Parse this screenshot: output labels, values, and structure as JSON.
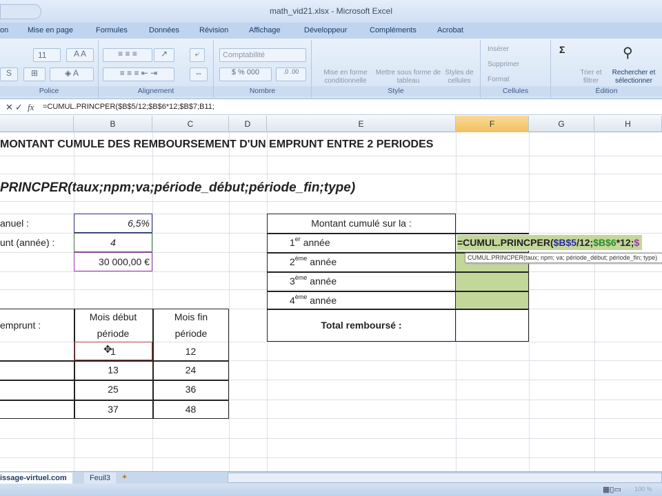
{
  "window": {
    "title": "math_vid21.xlsx - Microsoft Excel"
  },
  "ribbon_tabs": [
    "on",
    "Mise en page",
    "Formules",
    "Données",
    "Révision",
    "Affichage",
    "Développeur",
    "Compléments",
    "Acrobat"
  ],
  "ribbon": {
    "font_size": "11",
    "number_format": "Comptabilité",
    "groups": {
      "police": "Police",
      "alignement": "Alignement",
      "nombre": "Nombre",
      "style": "Style",
      "cellules": "Cellules",
      "edition": "Édition"
    },
    "style_buttons": [
      "Mise en forme conditionnelle",
      "Mettre sous forme de tableau",
      "Styles de cellules"
    ],
    "cell_buttons": [
      "Insérer",
      "Supprimer",
      "Format"
    ],
    "edit_buttons": [
      "Trier et filtrer",
      "Rechercher et sélectionner"
    ]
  },
  "formula_bar": {
    "formula": "=CUMUL.PRINCPER($B$5/12;$B$6*12;$B$7;B11;"
  },
  "columns": [
    "B",
    "C",
    "D",
    "E",
    "F",
    "G",
    "H"
  ],
  "sheet": {
    "title": "MONTANT CUMULE DES REMBOURSEMENT D'UN EMPRUNT ENTRE 2 PERIODES",
    "syntax": "PRINCPER(taux;npm;va;période_début;période_fin;type)",
    "labels": {
      "taux": "anuel :",
      "duree": "unt (année) :",
      "emprunt": "emprunt :"
    },
    "values": {
      "taux": "6,5%",
      "duree": "4",
      "montant": "30 000,00 €"
    },
    "periods_header": {
      "start": "Mois début période",
      "end": "Mois fin période"
    },
    "periods": [
      {
        "start": "1",
        "end": "12"
      },
      {
        "start": "13",
        "end": "24"
      },
      {
        "start": "25",
        "end": "36"
      },
      {
        "start": "37",
        "end": "48"
      }
    ],
    "cumul_header": "Montant cumulé sur la :",
    "years": [
      {
        "n": "1",
        "sup": "er",
        "label": "année"
      },
      {
        "n": "2",
        "sup": "ème",
        "label": "année"
      },
      {
        "n": "3",
        "sup": "ème",
        "label": "année"
      },
      {
        "n": "4",
        "sup": "ème",
        "label": "année"
      }
    ],
    "total_label": "Total remboursé :",
    "editing": {
      "prefix": "=CUMUL.PRINCPER(",
      "ref1": "$B$5",
      "mid1": "/12;",
      "ref2": "$B$6",
      "mid2": "*12;",
      "ref3": "$"
    },
    "tooltip": {
      "fn": "CUMUL.PRINCPER",
      "args": "(taux; npm; va; période_début; période_fin; type)"
    }
  },
  "sheet_tabs": [
    "issage-virtuel.com",
    "Feuil3"
  ],
  "status": {
    "zoom": "100 %"
  }
}
